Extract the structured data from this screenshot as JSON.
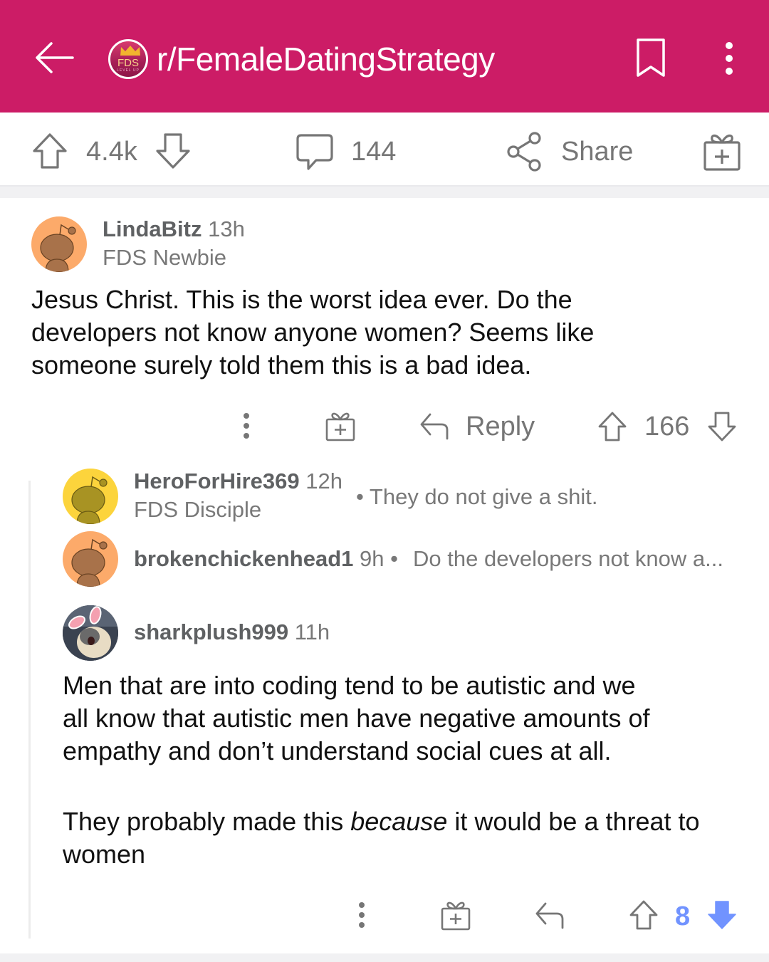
{
  "header": {
    "subreddit": "r/FemaleDatingStrategy",
    "subreddit_icon": {
      "text": "FDS",
      "subtext": "LEVEL UP"
    },
    "icons": [
      "back-arrow-icon",
      "bookmark-icon",
      "more-vertical-icon"
    ],
    "background_color": "#cc1c66"
  },
  "post_actions": {
    "score": "4.4k",
    "comments": "144",
    "share_label": "Share",
    "icons": [
      "upvote-icon",
      "downvote-icon",
      "comment-icon",
      "share-icon",
      "award-icon"
    ]
  },
  "comments": [
    {
      "username": "LindaBitz",
      "time": "13h",
      "flair": "FDS Newbie",
      "avatar_color": "#fcaa6a",
      "body_lines": [
        "Jesus Christ. This is the worst idea ever. Do the",
        "developers not know anyone women? Seems like",
        "someone surely told them this is a bad idea."
      ],
      "actions": {
        "reply_label": "Reply",
        "score": "166"
      }
    },
    {
      "username": "HeroForHire369",
      "time": "12h",
      "flair": "FDS Disciple",
      "avatar_color": "#fcd43c",
      "collapsed_text": "• They do not give a shit."
    },
    {
      "username": "brokenchickenhead1",
      "time": "9h",
      "separator": "•",
      "avatar_color": "#fcaa6a",
      "collapsed_text": "Do the developers not know a..."
    },
    {
      "username": "sharkplush999",
      "time": "11h",
      "avatar": "cat-with-bunny-ears-photo",
      "body_paragraph_1": [
        "Men that are into coding tend to be autistic and we",
        "all know that autistic men have negative amounts of",
        "empathy and don’t understand social cues at all."
      ],
      "body_paragraph_2": {
        "before": "They probably made this ",
        "emphasis": "because",
        "after": " it would be a threat to",
        "line2": "women"
      },
      "actions": {
        "score": "8",
        "vote_state": "downvoted",
        "vote_color": "#7193ff"
      }
    }
  ]
}
